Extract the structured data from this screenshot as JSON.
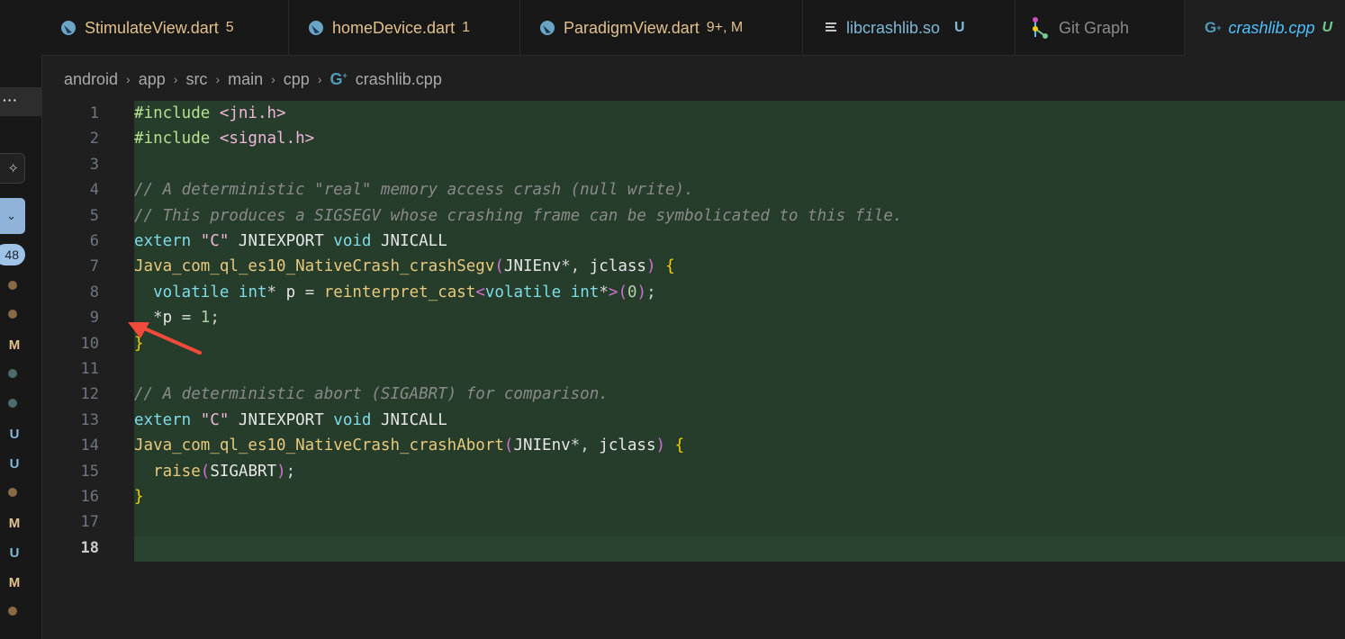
{
  "tabs": [
    {
      "name": "StimulateView.dart",
      "status": "5",
      "icon": "dart-icon"
    },
    {
      "name": "homeDevice.dart",
      "status": "1",
      "icon": "dart-icon"
    },
    {
      "name": "ParadigmView.dart",
      "status": "9+, M",
      "icon": "dart-icon"
    },
    {
      "name": "libcrashlib.so",
      "status": "U",
      "icon": "lines-icon"
    },
    {
      "name": "Git Graph",
      "status": "",
      "icon": "git-graph-icon"
    },
    {
      "name": "crashlib.cpp",
      "status": "U",
      "icon": "cpp-icon"
    }
  ],
  "breadcrumb": {
    "parts": [
      "android",
      "app",
      "src",
      "main",
      "cpp"
    ],
    "file": "crashlib.cpp"
  },
  "sidebar": {
    "more": "···",
    "badge": "48",
    "marks": [
      "M",
      "U",
      "U",
      "M",
      "U",
      "M"
    ]
  },
  "editor": {
    "line_numbers": [
      "1",
      "2",
      "3",
      "4",
      "5",
      "6",
      "7",
      "8",
      "9",
      "10",
      "11",
      "12",
      "13",
      "14",
      "15",
      "16",
      "17",
      "18"
    ],
    "current_line": "18",
    "lines": [
      "#include <jni.h>",
      "#include <signal.h>",
      "",
      "// A deterministic \"real\" memory access crash (null write).",
      "// This produces a SIGSEGV whose crashing frame can be symbolicated to this file.",
      "extern \"C\" JNIEXPORT void JNICALL",
      "Java_com_ql_es10_NativeCrash_crashSegv(JNIEnv*, jclass) {",
      "  volatile int* p = reinterpret_cast<volatile int*>(0);",
      "  *p = 1;",
      "}",
      "",
      "// A deterministic abort (SIGABRT) for comparison.",
      "extern \"C\" JNIEXPORT void JNICALL",
      "Java_com_ql_es10_NativeCrash_crashAbort(JNIEnv*, jclass) {",
      "  raise(SIGABRT);",
      "}",
      "",
      ""
    ]
  },
  "colors": {
    "accent": "#4fc1ff",
    "modified": "#e2c08d",
    "untracked": "#73c991",
    "highlight": "#263d2c",
    "arrow": "#f24b3c"
  }
}
